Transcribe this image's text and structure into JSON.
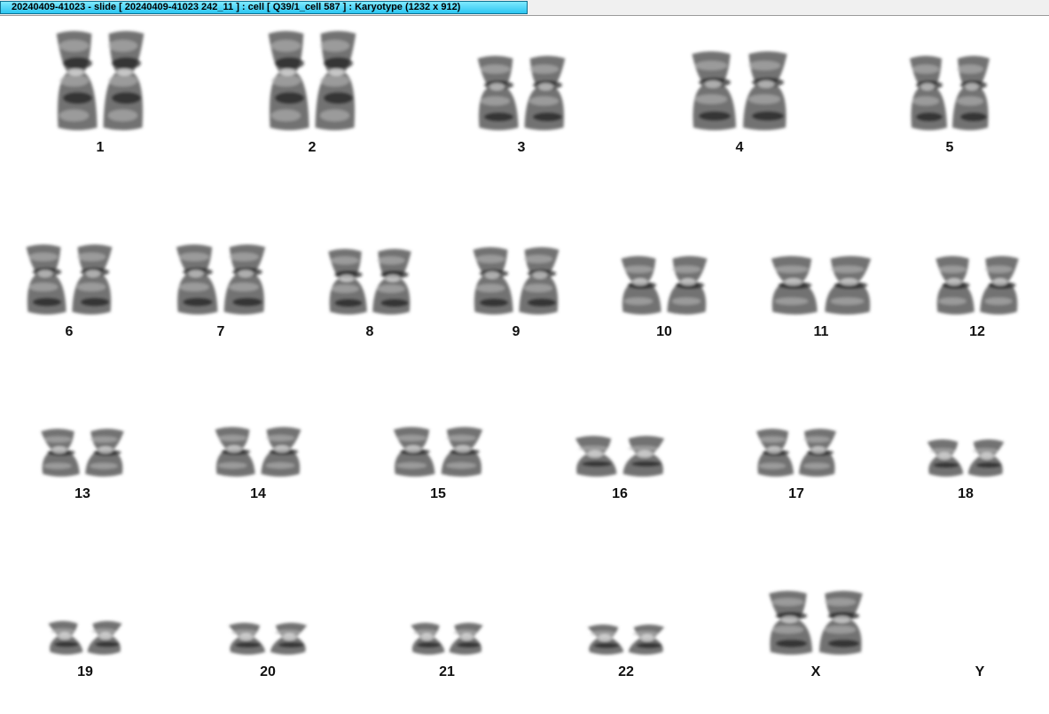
{
  "window": {
    "title": "20240409-41023 - slide [ 20240409-41023 242_11 ] : cell [ Q39/1_cell 587 ] : Karyotype  (1232 x 912)"
  },
  "karyotype": {
    "slots": [
      {
        "label": "1",
        "count": 2
      },
      {
        "label": "2",
        "count": 2
      },
      {
        "label": "3",
        "count": 2
      },
      {
        "label": "4",
        "count": 2
      },
      {
        "label": "5",
        "count": 2
      },
      {
        "label": "6",
        "count": 2
      },
      {
        "label": "7",
        "count": 2
      },
      {
        "label": "8",
        "count": 2
      },
      {
        "label": "9",
        "count": 2
      },
      {
        "label": "10",
        "count": 2
      },
      {
        "label": "11",
        "count": 2
      },
      {
        "label": "12",
        "count": 2
      },
      {
        "label": "13",
        "count": 2
      },
      {
        "label": "14",
        "count": 2
      },
      {
        "label": "15",
        "count": 2
      },
      {
        "label": "16",
        "count": 2
      },
      {
        "label": "17",
        "count": 2
      },
      {
        "label": "18",
        "count": 2
      },
      {
        "label": "19",
        "count": 2
      },
      {
        "label": "20",
        "count": 2
      },
      {
        "label": "21",
        "count": 2
      },
      {
        "label": "22",
        "count": 2
      },
      {
        "label": "X",
        "count": 2
      },
      {
        "label": "Y",
        "count": 0
      }
    ]
  }
}
